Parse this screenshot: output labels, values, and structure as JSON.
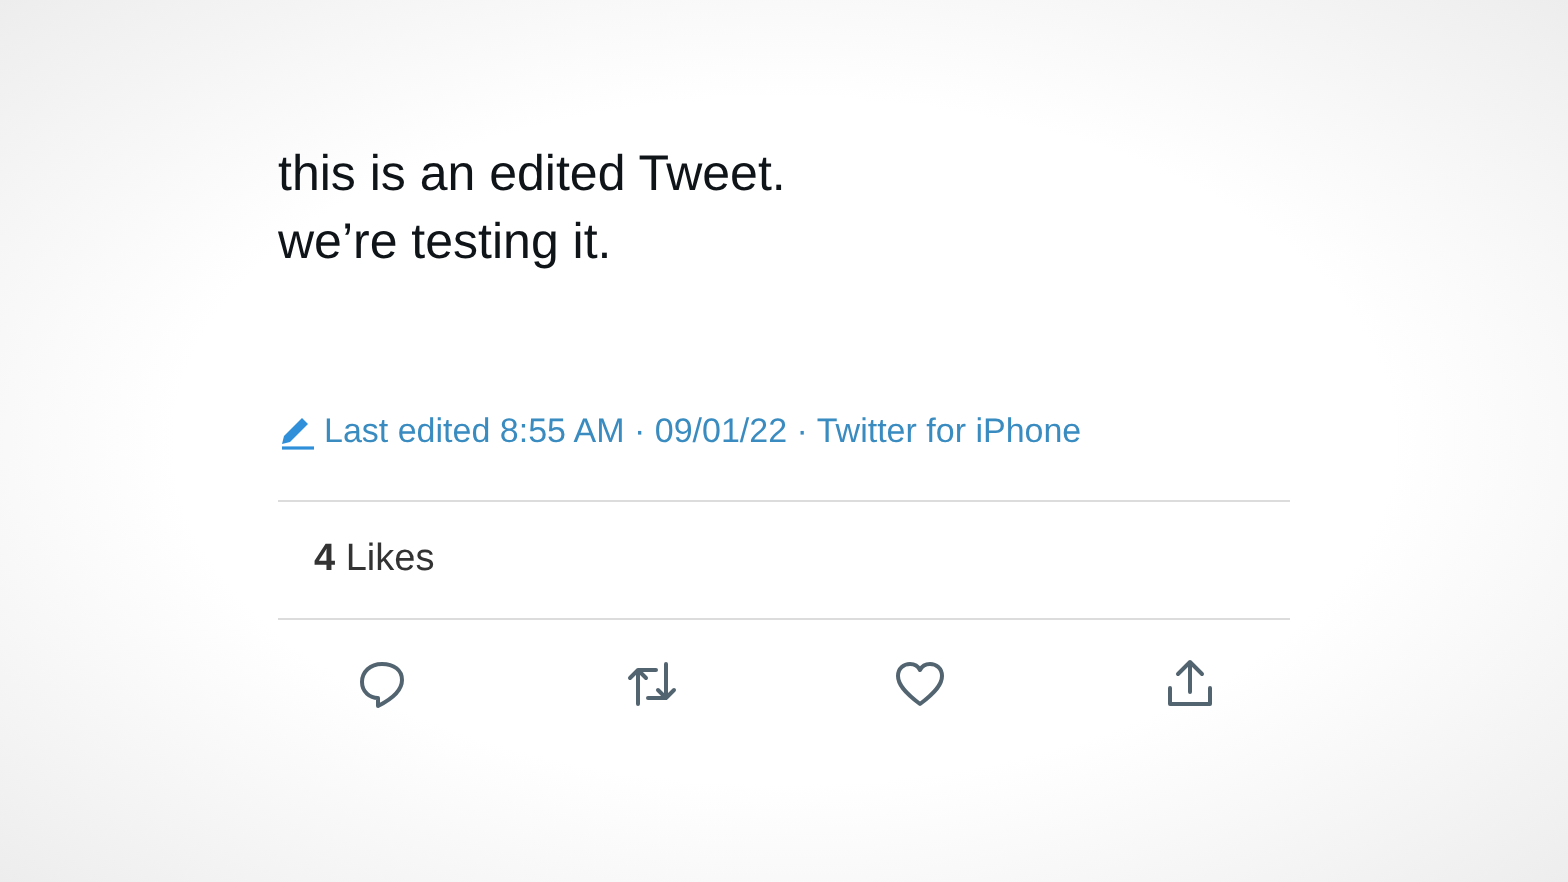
{
  "tweet": {
    "lines": [
      "this is an edited Tweet.",
      "we’re testing it."
    ]
  },
  "edit_info": "Last edited 8:55 AM · 09/01/22 · Twitter for iPhone",
  "likes": "**4** Likes",
  "actions": [
    {
      "kind": "reply"
    },
    {
      "kind": "retweet"
    },
    {
      "kind": "like"
    },
    {
      "kind": "share"
    }
  ]
}
